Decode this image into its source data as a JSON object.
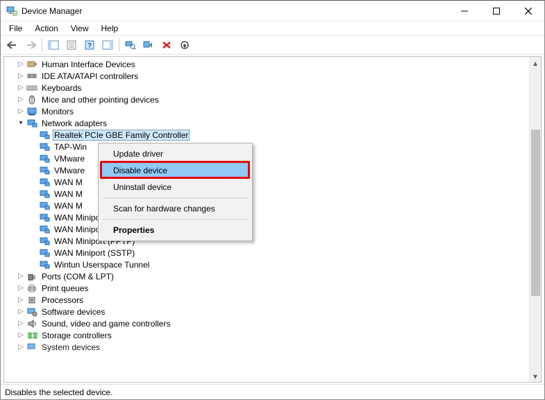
{
  "window": {
    "title": "Device Manager"
  },
  "menubar": {
    "items": [
      "File",
      "Action",
      "View",
      "Help"
    ]
  },
  "statusbar": {
    "text": "Disables the selected device."
  },
  "tree": {
    "categories": [
      {
        "label": "Human Interface Devices",
        "expanded": false,
        "icon": "hid"
      },
      {
        "label": "IDE ATA/ATAPI controllers",
        "expanded": false,
        "icon": "ide"
      },
      {
        "label": "Keyboards",
        "expanded": false,
        "icon": "keyboard"
      },
      {
        "label": "Mice and other pointing devices",
        "expanded": false,
        "icon": "mouse"
      },
      {
        "label": "Monitors",
        "expanded": false,
        "icon": "monitor"
      },
      {
        "label": "Network adapters",
        "expanded": true,
        "icon": "net",
        "children": [
          {
            "label": "Realtek PCIe GBE Family Controller",
            "icon": "net",
            "selected": true
          },
          {
            "label": "TAP-Win",
            "icon": "net",
            "truncated": true
          },
          {
            "label": "VMware",
            "icon": "net",
            "truncated": true
          },
          {
            "label": "VMware",
            "icon": "net",
            "truncated": true
          },
          {
            "label": "WAN M",
            "icon": "net",
            "truncated": true
          },
          {
            "label": "WAN M",
            "icon": "net",
            "truncated": true
          },
          {
            "label": "WAN M",
            "icon": "net",
            "truncated": true
          },
          {
            "label": "WAN Miniport (Network Monitor)",
            "icon": "net"
          },
          {
            "label": "WAN Miniport (PPPOE)",
            "icon": "net"
          },
          {
            "label": "WAN Miniport (PPTP)",
            "icon": "net"
          },
          {
            "label": "WAN Miniport (SSTP)",
            "icon": "net"
          },
          {
            "label": "Wintun Userspace Tunnel",
            "icon": "net"
          }
        ]
      },
      {
        "label": "Ports (COM & LPT)",
        "expanded": false,
        "icon": "ports"
      },
      {
        "label": "Print queues",
        "expanded": false,
        "icon": "printer"
      },
      {
        "label": "Processors",
        "expanded": false,
        "icon": "cpu"
      },
      {
        "label": "Software devices",
        "expanded": false,
        "icon": "software"
      },
      {
        "label": "Sound, video and game controllers",
        "expanded": false,
        "icon": "sound"
      },
      {
        "label": "Storage controllers",
        "expanded": false,
        "icon": "storage"
      },
      {
        "label": "System devices",
        "expanded": false,
        "icon": "system",
        "cut": true
      }
    ]
  },
  "context_menu": {
    "items": [
      {
        "label": "Update driver",
        "type": "item"
      },
      {
        "label": "Disable device",
        "type": "item",
        "highlight": true
      },
      {
        "label": "Uninstall device",
        "type": "item"
      },
      {
        "type": "sep"
      },
      {
        "label": "Scan for hardware changes",
        "type": "item"
      },
      {
        "type": "sep"
      },
      {
        "label": "Properties",
        "type": "item",
        "bold": true
      }
    ]
  }
}
